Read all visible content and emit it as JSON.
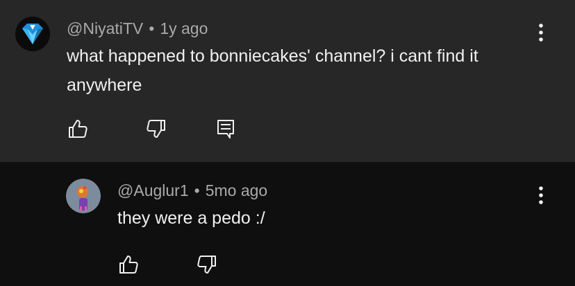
{
  "comment": {
    "author": "@NiyatiTV",
    "separator": "•",
    "time": "1y ago",
    "text": "what happened to bonniecakes' channel? i cant find it anywhere",
    "avatar_icon": "blue-diamond-logo-avatar",
    "actions": {
      "like_icon": "thumb-up-icon",
      "dislike_icon": "thumb-down-icon",
      "reply_icon": "reply-comment-icon",
      "more_icon": "vertical-dots-icon"
    }
  },
  "reply": {
    "author": "@Auglur1",
    "separator": "•",
    "time": "5mo ago",
    "text": "they were a pedo :/",
    "avatar_icon": "character-avatar",
    "actions": {
      "like_icon": "thumb-up-icon",
      "dislike_icon": "thumb-down-icon",
      "more_icon": "vertical-dots-icon"
    }
  },
  "colors": {
    "top_background": "#272727",
    "reply_background": "#0f0f0f",
    "text_primary": "#f1f1f1",
    "text_secondary": "#aaaaaa"
  }
}
